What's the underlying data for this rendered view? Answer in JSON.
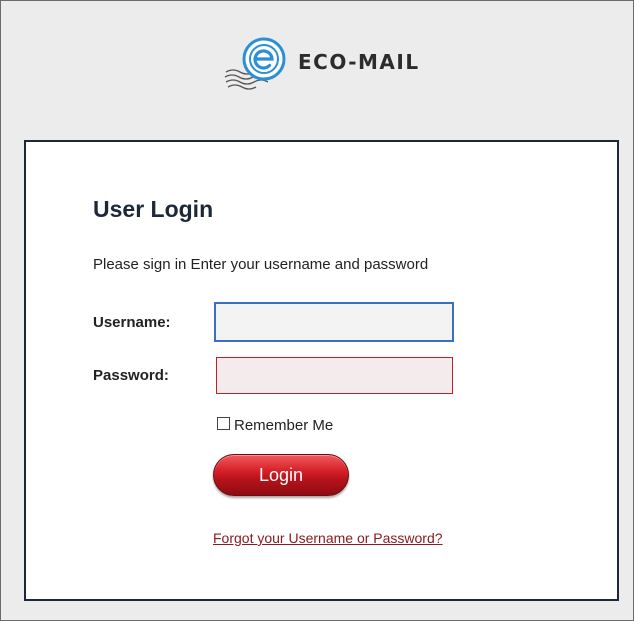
{
  "brand": {
    "name": "ECO-MAIL",
    "logo_icon": "eco-mail-postmark-logo",
    "logo_color": "#2a8fd6"
  },
  "login": {
    "title": "User Login",
    "subtitle": "Please sign in  Enter your username and password",
    "username_label": "Username:",
    "username_value": "",
    "password_label": "Password:",
    "password_value": "",
    "remember_label": "Remember Me",
    "remember_checked": false,
    "login_button": "Login",
    "forgot_link": "Forgot your Username or Password?"
  },
  "colors": {
    "accent_red": "#c0202a",
    "username_border": "#3a6fc4",
    "card_border": "#1c2738",
    "page_background": "#ececec"
  }
}
